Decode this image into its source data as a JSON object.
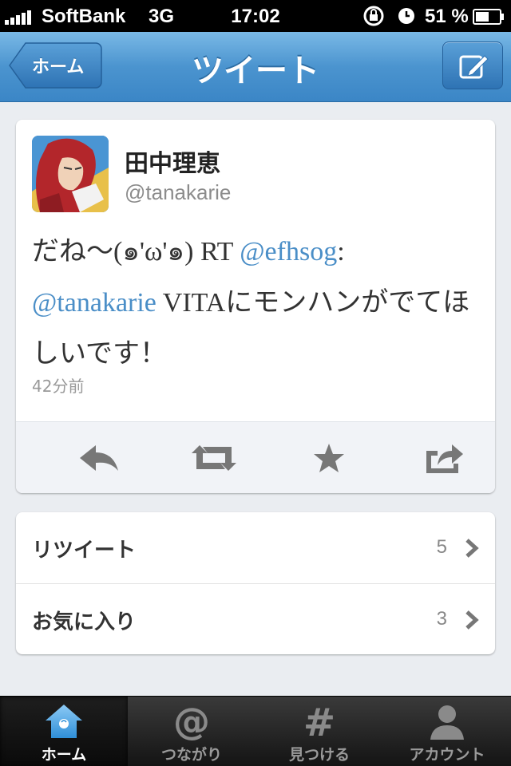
{
  "status_bar": {
    "carrier": "SoftBank",
    "network": "3G",
    "time": "17:02",
    "battery_percent": "51 %"
  },
  "nav": {
    "back_label": "ホーム",
    "title": "ツイート",
    "compose_icon": "compose-icon"
  },
  "tweet": {
    "user_name": "田中理恵",
    "user_handle": "@tanakarie",
    "text_part1": "だね〜(๑'ω'๑) RT ",
    "mention1": "@efhsog",
    "text_part2": ": ",
    "mention2": "@tanakarie",
    "text_part3": " VITAにモンハンがでてほしいです！",
    "timestamp": "42分前",
    "mention_color": "#4a8ec7"
  },
  "actions": [
    "reply-icon",
    "retweet-icon",
    "favorite-icon",
    "share-icon"
  ],
  "stats": [
    {
      "label": "リツイート",
      "count": "5"
    },
    {
      "label": "お気に入り",
      "count": "3"
    }
  ],
  "tabs": [
    {
      "label": "ホーム",
      "icon": "home-icon",
      "active": true
    },
    {
      "label": "つながり",
      "icon": "at-icon",
      "active": false
    },
    {
      "label": "見つける",
      "icon": "hash-icon",
      "active": false
    },
    {
      "label": "アカウント",
      "icon": "person-icon",
      "active": false
    }
  ],
  "colors": {
    "nav_blue": "#4b94cf",
    "background": "#eaedf1",
    "tab_bar": "#1e1e1e"
  }
}
